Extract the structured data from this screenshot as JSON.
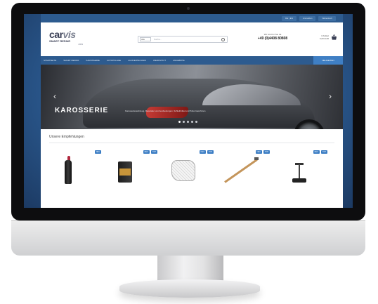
{
  "shop": {
    "topbar": {
      "buttons": [
        "DE | EN",
        "Anmelden",
        "Warenkorb"
      ]
    },
    "logo": {
      "main_a": "car",
      "main_b": "vis",
      "sub": "SMART REPAIR",
      "year": "2009"
    },
    "search": {
      "category": "Alle",
      "placeholder": "Suche..."
    },
    "contact": {
      "line": "Wir sind fur Sie da",
      "phone": "+49 (0)4408 80808"
    },
    "cart": {
      "line1": "0 Artikel",
      "line2": "0,00 EUR"
    },
    "nav": {
      "items": [
        "STARTSEITE",
        "SMART REPAIR",
        "KAROSSERIE",
        "AUTOPFLEGE",
        "LACKIERTECHNIK",
        "WERKSTATT",
        "ANGEBOTE"
      ],
      "cta": "NEUHEITEN"
    },
    "hero": {
      "title": "KAROSSERIE",
      "subtitle": "Karosseriewerkzeug, Reparatur von Ausbeulungen, Schleifmittel und Poliermaschinen"
    },
    "recommendations": {
      "title": "Unsere Empfehlungen",
      "products": [
        {
          "name": "polish-bottle",
          "badges": [
            "NEU"
          ]
        },
        {
          "name": "paint-can",
          "badges": [
            "NEU",
            "TOP"
          ]
        },
        {
          "name": "tool-set",
          "badges": [
            "NEU",
            "TOP"
          ]
        },
        {
          "name": "slide-hammer",
          "badges": [
            "NEU",
            "TOP"
          ]
        },
        {
          "name": "dent-puller",
          "badges": [
            "NEU",
            "TOP"
          ]
        }
      ]
    }
  },
  "colors": {
    "brand_blue": "#2d5b8f",
    "accent_blue": "#3f7fc4",
    "bezel": "#0d0d0f"
  },
  "icons": {
    "search": "search-icon",
    "cart": "basket-icon",
    "prev": "chevron-left-icon",
    "next": "chevron-right-icon"
  }
}
